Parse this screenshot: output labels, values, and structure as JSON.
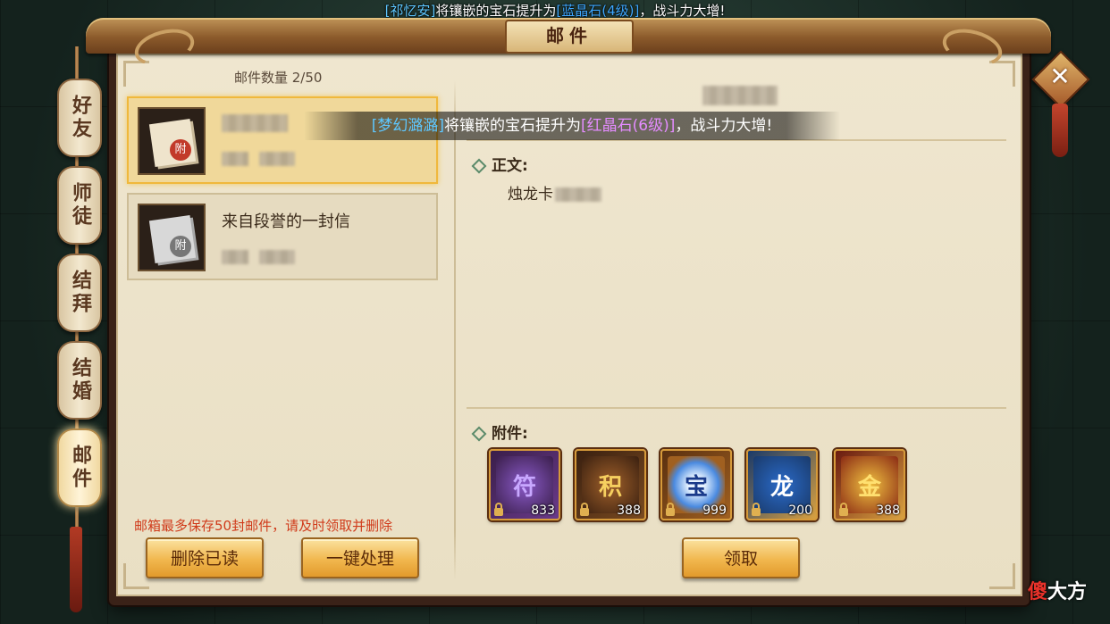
{
  "broadcast_top": {
    "name": "[祁忆安]",
    "action": "将镶嵌的宝石提升为",
    "gem": "[蓝晶石(4级)]",
    "suffix": "，战斗力大增!"
  },
  "broadcast_mid": {
    "name": "[梦幻潞潞]",
    "action": "将镶嵌的宝石提升为",
    "gem": "[红晶石(6级)]",
    "suffix": "，战斗力大增!"
  },
  "window": {
    "title": "邮件",
    "close_icon": "✕"
  },
  "side_tabs": [
    {
      "label": "好友"
    },
    {
      "label": "师徒"
    },
    {
      "label": "结拜"
    },
    {
      "label": "结婚"
    },
    {
      "label": "邮件",
      "active": true
    }
  ],
  "mail_list": {
    "count_label": "邮件数量 2/50",
    "items": [
      {
        "title": "",
        "seal": "附",
        "selected": true
      },
      {
        "title": "来自段誉的一封信",
        "seal": "附",
        "selected": false
      }
    ],
    "retention_notice": "邮箱最多保存50封邮件，请及时领取并删除",
    "delete_read_label": "删除已读",
    "one_click_label": "一键处理"
  },
  "detail": {
    "body_label": "正文:",
    "body_text": "烛龙卡",
    "attachments_label": "附件:",
    "attachments": [
      {
        "icon": "scroll-icon",
        "glyph": "符",
        "count": "833"
      },
      {
        "icon": "points-chest-icon",
        "glyph": "积",
        "count": "388"
      },
      {
        "icon": "orb-icon",
        "glyph": "宝",
        "count": "999"
      },
      {
        "icon": "dragon-chest-icon",
        "glyph": "龙",
        "count": "200"
      },
      {
        "icon": "gold-chest-icon",
        "glyph": "金",
        "count": "388"
      }
    ],
    "claim_label": "领取"
  },
  "watermark": {
    "red": "傻",
    "white": "大方"
  }
}
